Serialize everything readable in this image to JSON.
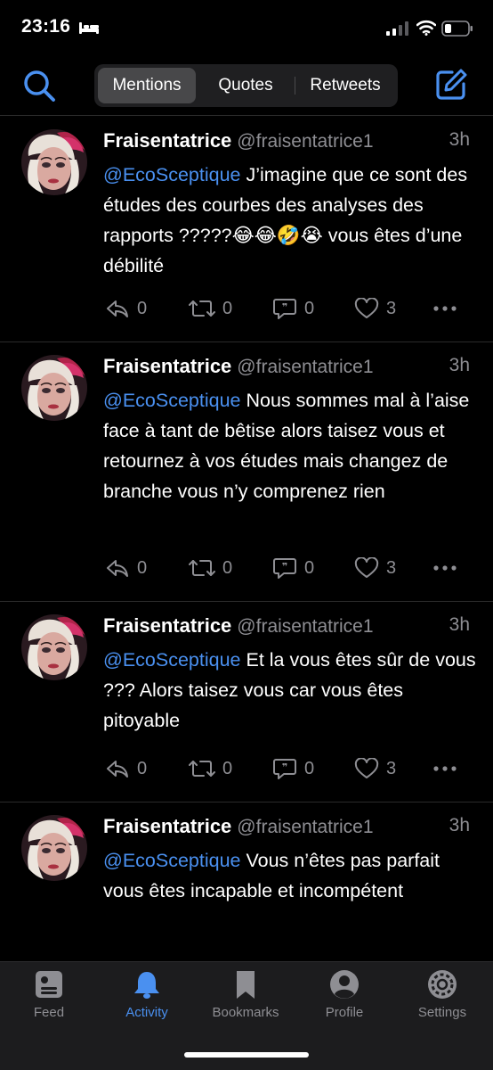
{
  "status_bar": {
    "time": "23:16"
  },
  "header": {
    "tabs": [
      {
        "label": "Mentions",
        "active": true
      },
      {
        "label": "Quotes",
        "active": false
      },
      {
        "label": "Retweets",
        "active": false
      }
    ],
    "accent_color": "#4a90f0"
  },
  "tweets": [
    {
      "name": "Fraisentatrice",
      "handle": "@fraisentatrice1",
      "time": "3h",
      "mention": "@EcoSceptique",
      "text": " J’imagine que ce sont des études des courbes des analyses des rapports ?????😂😂🤣😭 vous êtes d’une débilité",
      "replies": "0",
      "retweets": "0",
      "quotes": "0",
      "likes": "3"
    },
    {
      "name": "Fraisentatrice",
      "handle": "@fraisentatrice1",
      "time": "3h",
      "mention": "@EcoSceptique",
      "text": " Nous sommes mal à l’aise face à tant de bêtise alors taisez vous et retournez à vos études mais changez de branche vous n’y comprenez rien",
      "replies": "0",
      "retweets": "0",
      "quotes": "0",
      "likes": "3"
    },
    {
      "name": "Fraisentatrice",
      "handle": "@fraisentatrice1",
      "time": "3h",
      "mention": "@EcoSceptique",
      "text": " Et la vous êtes sûr de vous ??? Alors taisez vous car vous êtes pitoyable",
      "replies": "0",
      "retweets": "0",
      "quotes": "0",
      "likes": "3"
    },
    {
      "name": "Fraisentatrice",
      "handle": "@fraisentatrice1",
      "time": "3h",
      "mention": "@EcoSceptique",
      "text": " Vous n’êtes pas parfait vous êtes incapable et incompétent"
    }
  ],
  "tabbar": {
    "items": [
      {
        "label": "Feed",
        "icon": "feed-icon",
        "active": false
      },
      {
        "label": "Activity",
        "icon": "bell-icon",
        "active": true
      },
      {
        "label": "Bookmarks",
        "icon": "bookmark-icon",
        "active": false
      },
      {
        "label": "Profile",
        "icon": "profile-icon",
        "active": false
      },
      {
        "label": "Settings",
        "icon": "gear-icon",
        "active": false
      }
    ]
  }
}
